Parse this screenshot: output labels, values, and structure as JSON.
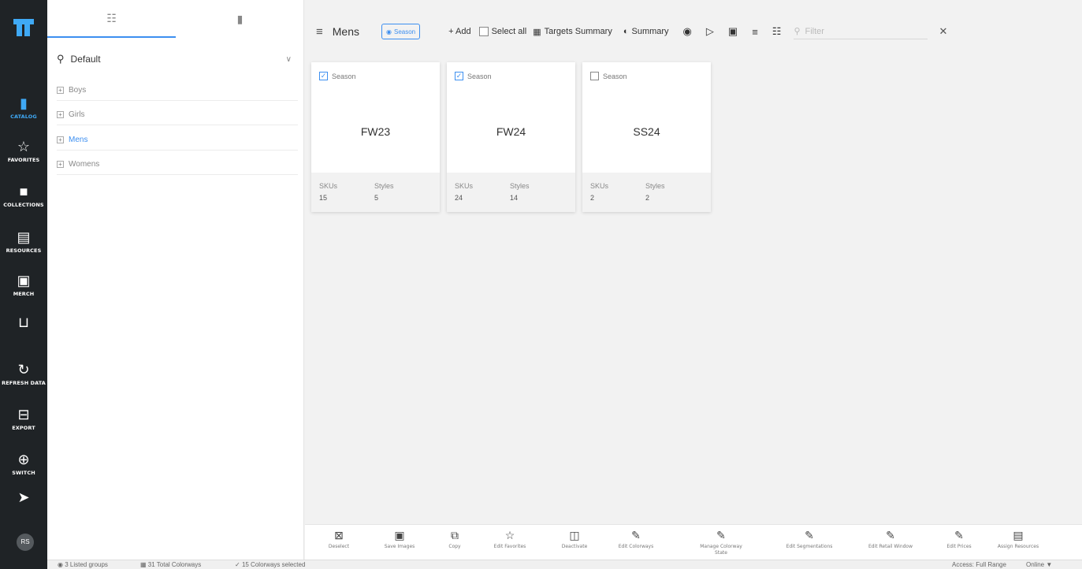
{
  "nav": {
    "items": [
      {
        "label": "CATALOG",
        "icon": "catalog-icon"
      },
      {
        "label": "FAVORITES",
        "icon": "star-icon"
      },
      {
        "label": "COLLECTIONS",
        "icon": "collections-icon"
      },
      {
        "label": "RESOURCES",
        "icon": "resources-icon"
      },
      {
        "label": "MERCH",
        "icon": "merch-icon"
      },
      {
        "label": "",
        "icon": "cart-icon"
      },
      {
        "label": "REFRESH DATA",
        "icon": "refresh-icon"
      },
      {
        "label": "EXPORT",
        "icon": "export-icon"
      },
      {
        "label": "SWITCH",
        "icon": "switch-icon"
      },
      {
        "label": "",
        "icon": "rocket-icon"
      }
    ],
    "avatar": "RS",
    "accent": "#3fa9f5"
  },
  "tree": {
    "search_value": "Default",
    "items": [
      {
        "label": "Boys"
      },
      {
        "label": "Girls"
      },
      {
        "label": "Mens"
      },
      {
        "label": "Womens"
      }
    ]
  },
  "toolbar": {
    "title": "Mens",
    "pill": "Season",
    "add": "+ Add",
    "select_all": "Select all",
    "targets": "Targets Summary",
    "summary": "Summary",
    "filter_placeholder": "Filter"
  },
  "cards": [
    {
      "header": "Season",
      "checked": true,
      "name": "FW23",
      "skus_label": "SKUs",
      "skus": "15",
      "styles_label": "Styles",
      "styles": "5"
    },
    {
      "header": "Season",
      "checked": true,
      "name": "FW24",
      "skus_label": "SKUs",
      "skus": "24",
      "styles_label": "Styles",
      "styles": "14"
    },
    {
      "header": "Season",
      "checked": false,
      "name": "SS24",
      "skus_label": "SKUs",
      "skus": "2",
      "styles_label": "Styles",
      "styles": "2"
    }
  ],
  "actions": [
    {
      "label": "Deselect",
      "icon": "deselect-icon"
    },
    {
      "label": "Save Images",
      "icon": "save-images-icon"
    },
    {
      "label": "Copy",
      "icon": "copy-icon"
    },
    {
      "label": "Edit Favorites",
      "icon": "star-icon"
    },
    {
      "label": "Deactivate",
      "icon": "trash-icon"
    },
    {
      "label": "Edit Colorways",
      "icon": "pencil-icon"
    },
    {
      "label": "Manage Colorway State",
      "icon": "pencil-icon"
    },
    {
      "label": "Edit Segmentations",
      "icon": "pencil-icon"
    },
    {
      "label": "Edit Retail Window",
      "icon": "pencil-icon"
    },
    {
      "label": "Edit Prices",
      "icon": "pencil-icon"
    },
    {
      "label": "Assign Resources",
      "icon": "resources-icon"
    }
  ],
  "status": {
    "listed": "3 Listed groups",
    "total": "31 Total Colorways",
    "selected": "15 Colorways selected",
    "access": "Access: Full Range",
    "online": "Online"
  }
}
